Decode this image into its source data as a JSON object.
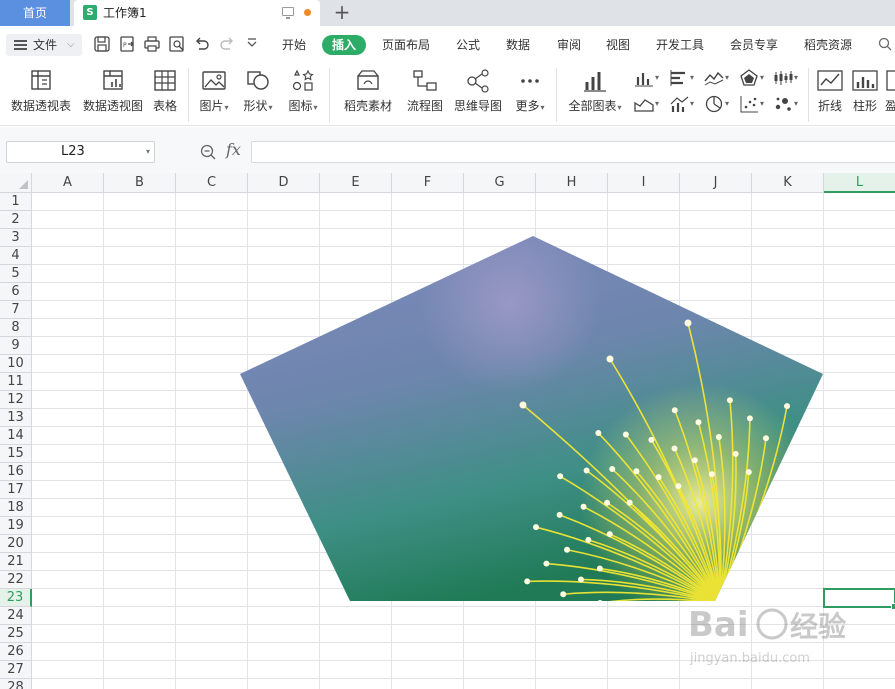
{
  "tabs": {
    "home": "首页",
    "doc_icon": "S",
    "doc_title": "工作簿1",
    "new_tab": "+"
  },
  "menu": {
    "file": "文件",
    "items": [
      "开始",
      "插入",
      "页面布局",
      "公式",
      "数据",
      "审阅",
      "视图",
      "开发工具",
      "会员专享",
      "稻壳资源"
    ],
    "active": "插入"
  },
  "ribbon": {
    "pivot_table": "数据透视表",
    "pivot_chart": "数据透视图",
    "table": "表格",
    "picture": "图片",
    "shape": "形状",
    "icon": "图标",
    "docer_material": "稻壳素材",
    "flowchart": "流程图",
    "mindmap": "思维导图",
    "more": "更多",
    "all_charts": "全部图表",
    "line": "折线",
    "column": "柱形",
    "win_loss": "盈"
  },
  "formula_bar": {
    "name_box": "L23",
    "fx": "fx",
    "value": ""
  },
  "grid": {
    "columns": [
      "A",
      "B",
      "C",
      "D",
      "E",
      "F",
      "G",
      "H",
      "I",
      "J",
      "K",
      "L"
    ],
    "rows": [
      "1",
      "2",
      "3",
      "4",
      "5",
      "6",
      "7",
      "8",
      "9",
      "10",
      "11",
      "12",
      "13",
      "14",
      "15",
      "16",
      "17",
      "18",
      "19",
      "20",
      "21",
      "22",
      "23",
      "24",
      "25",
      "26",
      "27",
      "28"
    ],
    "selected_cell": "L23"
  },
  "watermark": {
    "logo": "Bai 经验",
    "url": "jingyan.baidu.com"
  },
  "colors": {
    "accent_green": "#2dac68",
    "home_tab_blue": "#5b8fe0",
    "unsaved_dot": "#f08a24"
  }
}
